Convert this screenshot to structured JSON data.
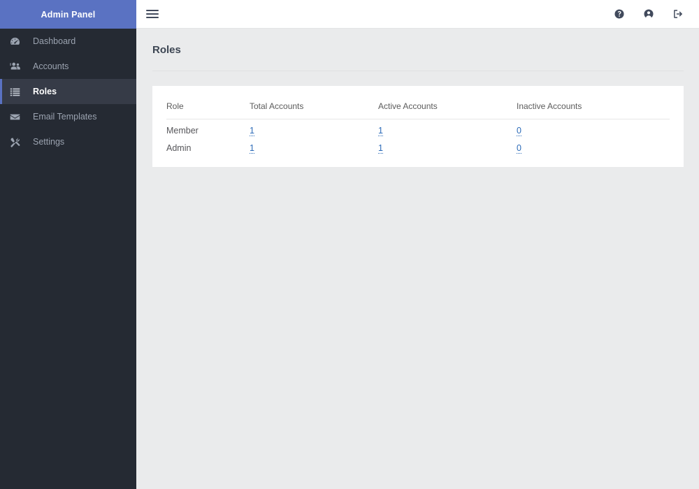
{
  "sidebar": {
    "brand": "Admin Panel",
    "items": [
      {
        "label": "Dashboard",
        "icon": "dashboard-icon",
        "active": false
      },
      {
        "label": "Accounts",
        "icon": "users-icon",
        "active": false
      },
      {
        "label": "Roles",
        "icon": "list-icon",
        "active": true
      },
      {
        "label": "Email Templates",
        "icon": "envelope-icon",
        "active": false
      },
      {
        "label": "Settings",
        "icon": "tools-icon",
        "active": false
      }
    ]
  },
  "topbar": {
    "menu_icon": "hamburger-icon",
    "help_icon": "question-circle-icon",
    "account_icon": "user-circle-icon",
    "logout_icon": "sign-out-icon"
  },
  "page": {
    "title": "Roles"
  },
  "table": {
    "columns": [
      "Role",
      "Total Accounts",
      "Active Accounts",
      "Inactive Accounts"
    ],
    "rows": [
      {
        "role": "Member",
        "total": "1",
        "active": "1",
        "inactive": "0"
      },
      {
        "role": "Admin",
        "total": "1",
        "active": "1",
        "inactive": "0"
      }
    ]
  },
  "colors": {
    "brand_blue": "#5a72c2",
    "sidebar_bg": "#252a33",
    "sidebar_active_bg": "#363b47",
    "page_bg": "#eaebec",
    "link_blue": "#2c6bb8"
  }
}
